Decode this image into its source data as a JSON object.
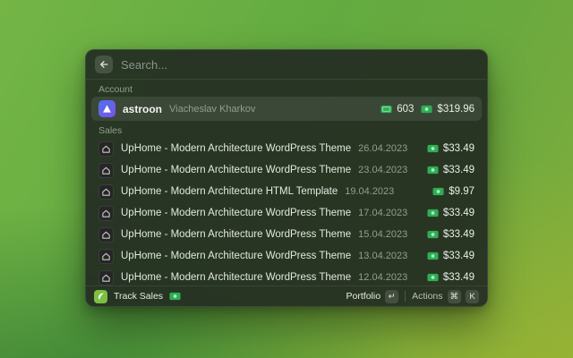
{
  "search": {
    "placeholder": "Search..."
  },
  "account": {
    "header": "Account",
    "name": "astroon",
    "subtitle": "Viacheslav Kharkov",
    "sales_count": "603",
    "balance": "$319.96"
  },
  "sales": {
    "header": "Sales",
    "items": [
      {
        "title": "UpHome - Modern Architecture WordPress Theme",
        "date": "26.04.2023",
        "amount": "$33.49"
      },
      {
        "title": "UpHome - Modern Architecture WordPress Theme",
        "date": "23.04.2023",
        "amount": "$33.49"
      },
      {
        "title": "UpHome - Modern Architecture HTML Template",
        "date": "19.04.2023",
        "amount": "$9.97"
      },
      {
        "title": "UpHome - Modern Architecture WordPress Theme",
        "date": "17.04.2023",
        "amount": "$33.49"
      },
      {
        "title": "UpHome - Modern Architecture WordPress Theme",
        "date": "15.04.2023",
        "amount": "$33.49"
      },
      {
        "title": "UpHome - Modern Architecture WordPress Theme",
        "date": "13.04.2023",
        "amount": "$33.49"
      },
      {
        "title": "UpHome - Modern Architecture WordPress Theme",
        "date": "12.04.2023",
        "amount": "$33.49"
      }
    ]
  },
  "footer": {
    "extension_name": "Track Sales",
    "primary_action": "Portfolio",
    "enter_key": "↵",
    "actions_label": "Actions",
    "cmd_key": "⌘",
    "k_key": "K"
  },
  "colors": {
    "accent_green": "#2fae54",
    "desktop_green": "#6bb044",
    "panel_dark": "#242e22"
  }
}
